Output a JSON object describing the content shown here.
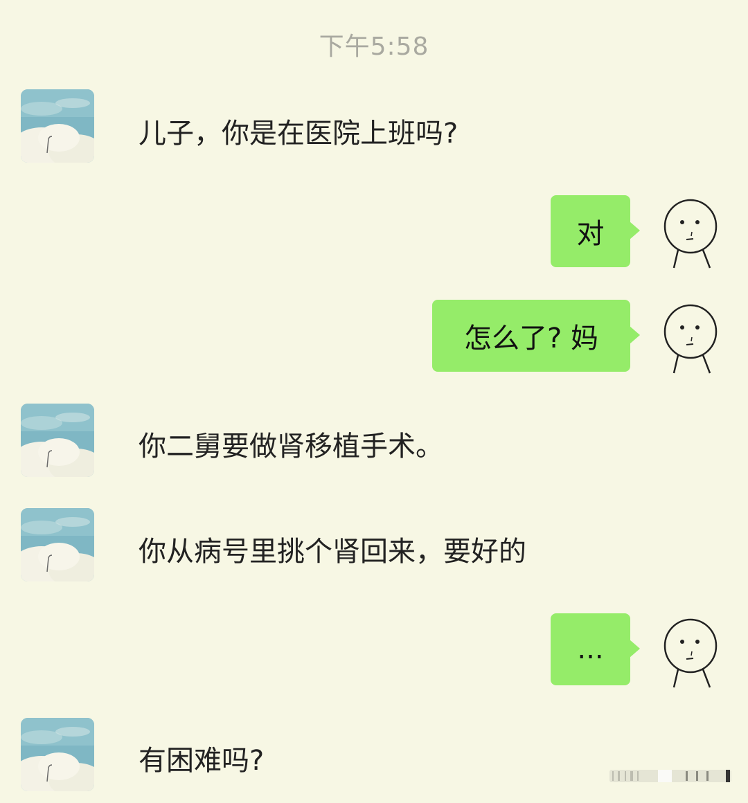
{
  "timestamp": "下午5:58",
  "messages": [
    {
      "side": "left",
      "text": "儿子，你是在医院上班吗?"
    },
    {
      "side": "right",
      "text": "对"
    },
    {
      "side": "right",
      "text": "怎么了? 妈"
    },
    {
      "side": "left",
      "text": "你二舅要做肾移植手术。"
    },
    {
      "side": "left",
      "text": "你从病号里挑个肾回来，要好的"
    },
    {
      "side": "right",
      "text": "..."
    },
    {
      "side": "left",
      "text": "有困难吗?"
    }
  ],
  "colors": {
    "background": "#f7f7e4",
    "bubble_green": "#95ec69",
    "timestamp_gray": "#a9a9a0"
  },
  "icons": {
    "mom_avatar": "cloud-sky-avatar",
    "son_avatar": "stick-face-avatar"
  }
}
